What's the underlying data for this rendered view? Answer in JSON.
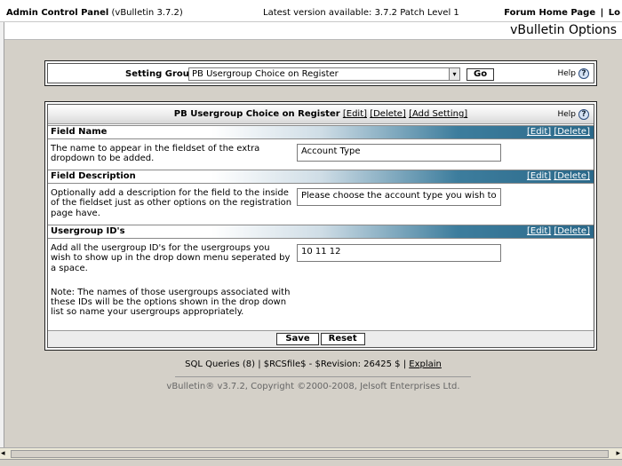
{
  "topbar": {
    "panel_title": "Admin Control Panel",
    "version": "(vBulletin 3.7.2)",
    "latest_version": "Latest version available: 3.7.2 Patch Level 1",
    "forum_home": "Forum Home Page",
    "logout_partial": "Lo"
  },
  "header": {
    "title": "vBulletin Options"
  },
  "setting_group": {
    "label": "Setting Group",
    "selected": "PB Usergroup Choice on Register",
    "go_label": "Go",
    "help_label": "Help",
    "help_icon": "?"
  },
  "group_table": {
    "title": "PB Usergroup Choice on Register",
    "edit_link": "[Edit]",
    "delete_link": "[Delete]",
    "add_setting_link": "[Add Setting]",
    "help_label": "Help",
    "help_icon": "?",
    "field_name_heading": "Field Name",
    "settings": [
      {
        "name": "Field Name",
        "edit": "[Edit]",
        "delete": "[Delete]",
        "description": "The name to appear in the fieldset of the extra dropdown to be added.",
        "value": "Account Type"
      },
      {
        "name": "Field Description",
        "edit": "[Edit]",
        "delete": "[Delete]",
        "description": "Optionally add a description for the field to the inside of the fieldset just as other options on the registration page have.",
        "value": "Please choose the account type you wish to"
      },
      {
        "name": "Usergroup ID's",
        "edit": "[Edit]",
        "delete": "[Delete]",
        "description": "Add all the usergroup ID's for the usergroups you wish to show up in the drop down menu seperated by a space.",
        "note": "Note: The names of those usergroups associated with these IDs will be the options shown in the drop down list so name your usergroups appropriately.",
        "value": "10 11 12"
      }
    ],
    "save_label": "Save",
    "reset_label": "Reset"
  },
  "footer": {
    "queries": "SQL Queries (8) | $RCSfile$ - $Revision: 26425 $ |",
    "explain": "Explain",
    "copyright": "vBulletin® v3.7.2, Copyright ©2000-2008, Jelsoft Enterprises Ltd."
  }
}
